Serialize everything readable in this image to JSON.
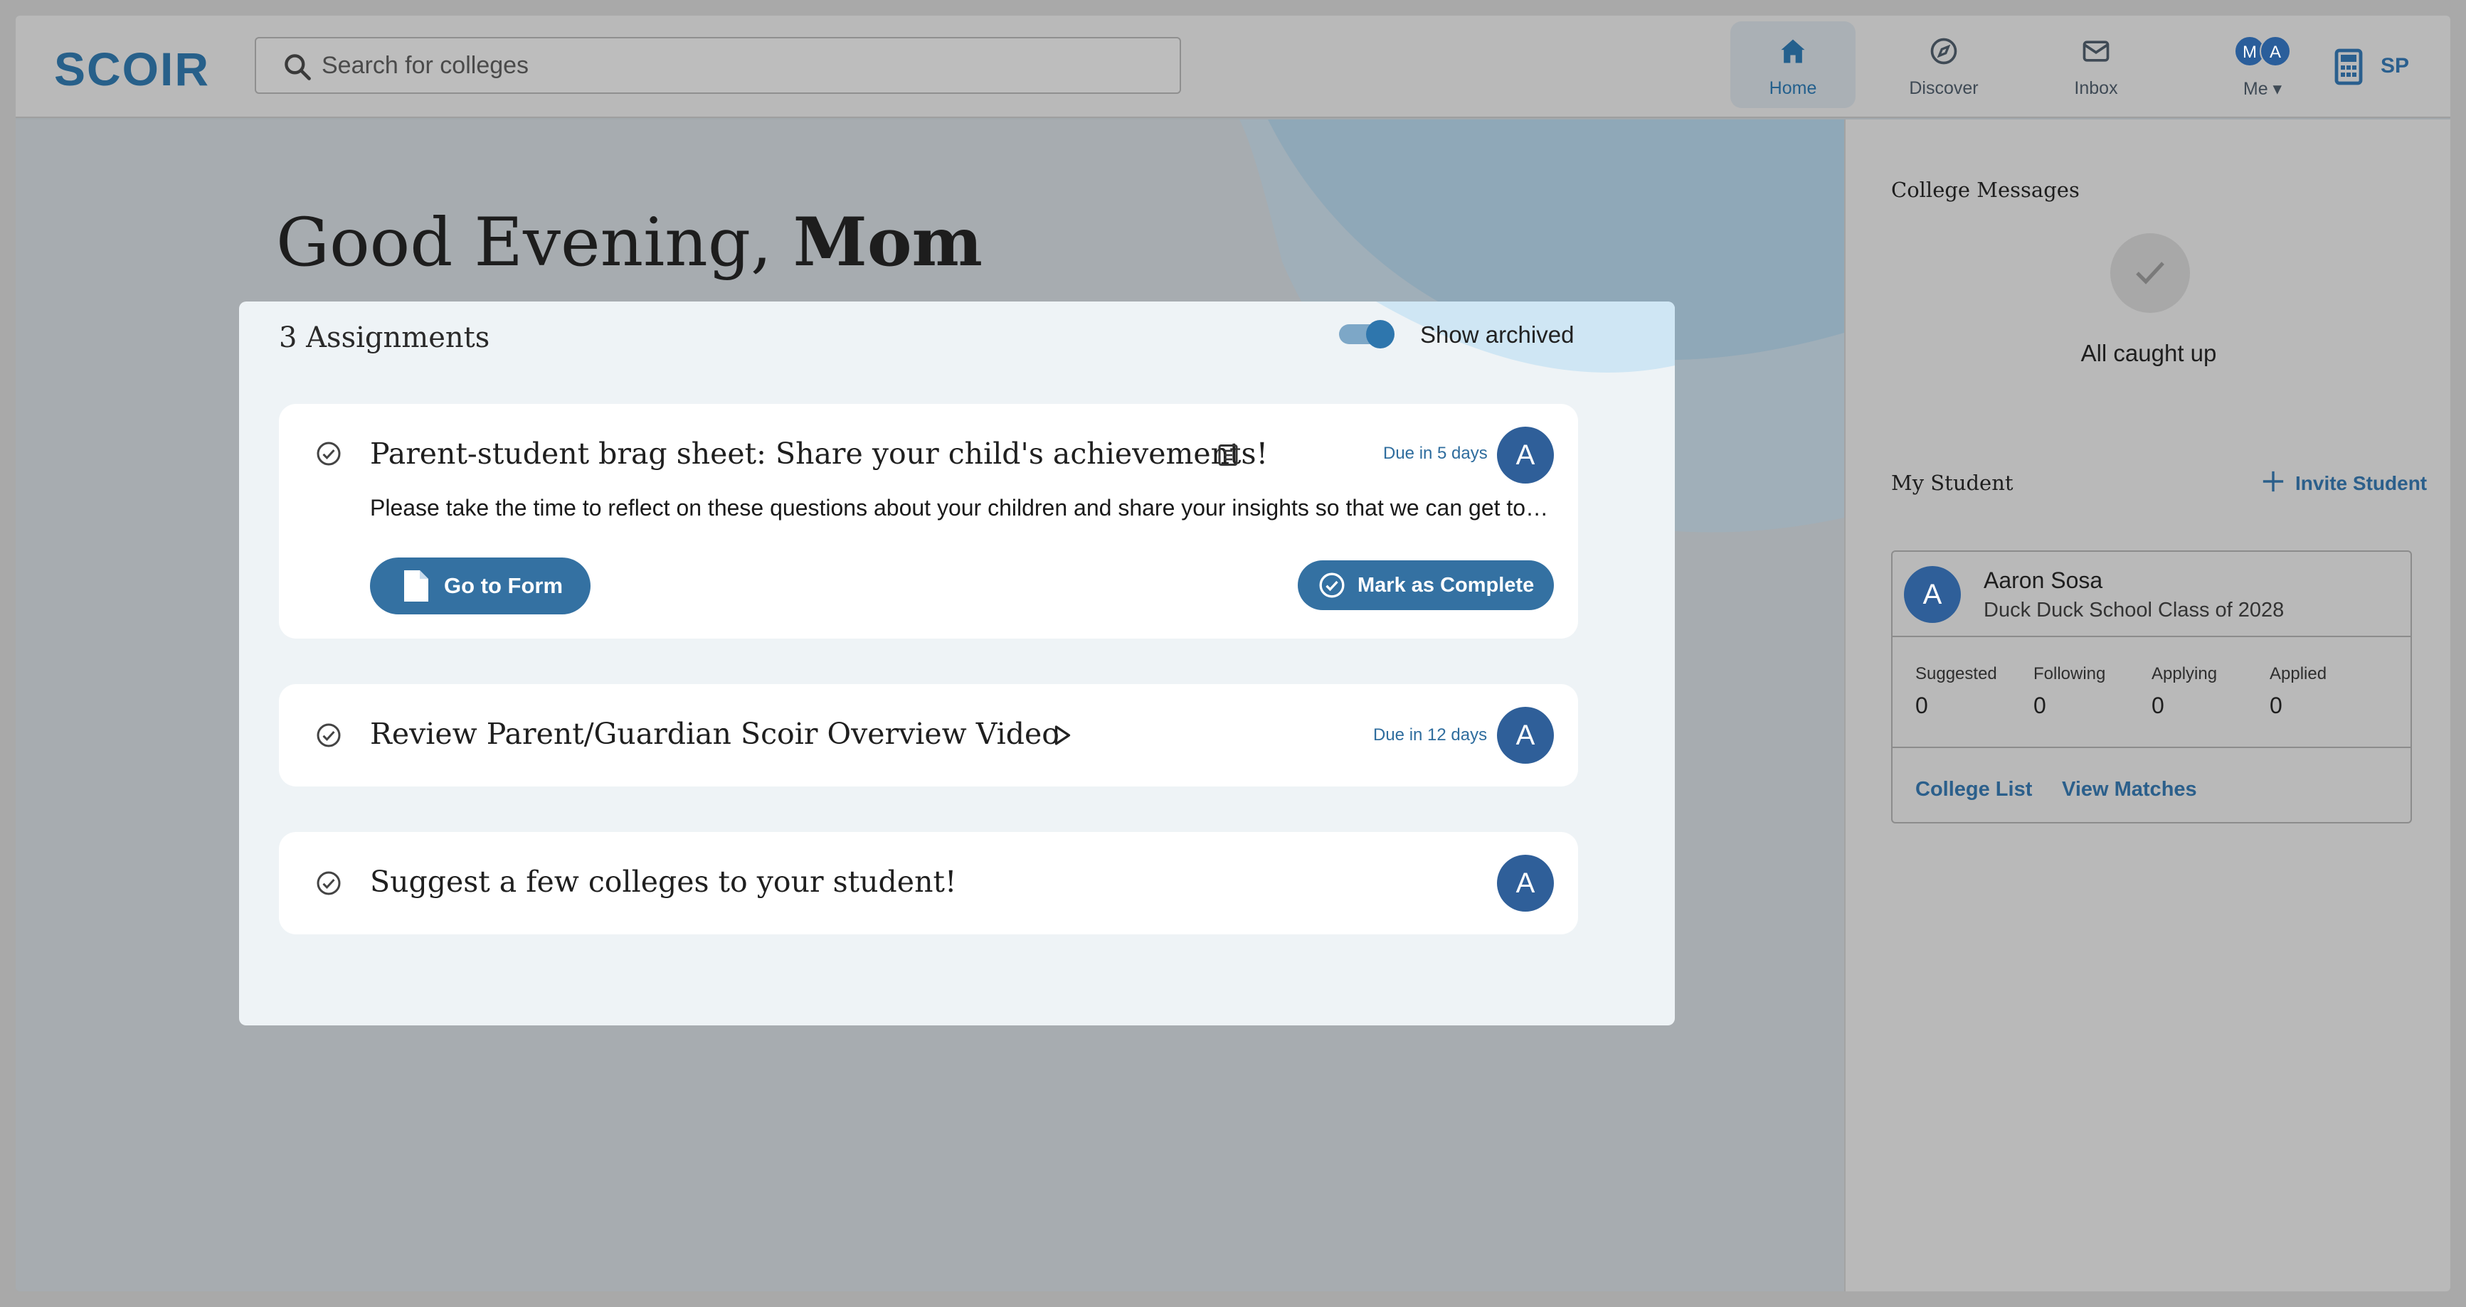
{
  "header": {
    "logo": "SCOIR",
    "search": {
      "placeholder": "Search for colleges",
      "value": ""
    },
    "nav": [
      {
        "label": "Home",
        "icon": "home-icon"
      },
      {
        "label": "Discover",
        "icon": "compass-icon"
      },
      {
        "label": "Inbox",
        "icon": "inbox-icon"
      },
      {
        "label": "Me ▾",
        "icon": "avatars"
      }
    ],
    "me_avatars": [
      "M",
      "A"
    ],
    "sp_label": "SP"
  },
  "main": {
    "greeting_prefix": "Good Evening, ",
    "greeting_name": "Mom",
    "assignments_count": "3 Assignments",
    "show_archived_label": "Show archived",
    "show_archived_on": true,
    "assignments": [
      {
        "title": "Parent-student brag sheet: Share your child's achievements!",
        "type_icon": "form-icon",
        "due": "Due in 5 days",
        "avatar": "A",
        "description": "Please take the time to reflect on these questions about your children and share your insights so that we can get to know them better.",
        "primary_button": "Go to Form",
        "secondary_button": "Mark as Complete"
      },
      {
        "title": "Review Parent/Guardian Scoir Overview Video",
        "type_icon": "play-icon",
        "due": "Due in 12 days",
        "avatar": "A"
      },
      {
        "title": "Suggest a few colleges to your student!",
        "avatar": "A"
      }
    ]
  },
  "sidebar": {
    "messages_heading": "College Messages",
    "caught_up": "All caught up",
    "my_student_heading": "My Student",
    "invite_label": "Invite Student",
    "student": {
      "initial": "A",
      "name": "Aaron Sosa",
      "school": "Duck Duck School Class of 2028",
      "stats": [
        {
          "label": "Suggested",
          "value": "0"
        },
        {
          "label": "Following",
          "value": "0"
        },
        {
          "label": "Applying",
          "value": "0"
        },
        {
          "label": "Applied",
          "value": "0"
        }
      ],
      "links": [
        "College List",
        "View Matches"
      ]
    }
  },
  "colors": {
    "brand": "#3471a2",
    "avatar": "#2f5f99",
    "overlay": "#a7acb0"
  }
}
